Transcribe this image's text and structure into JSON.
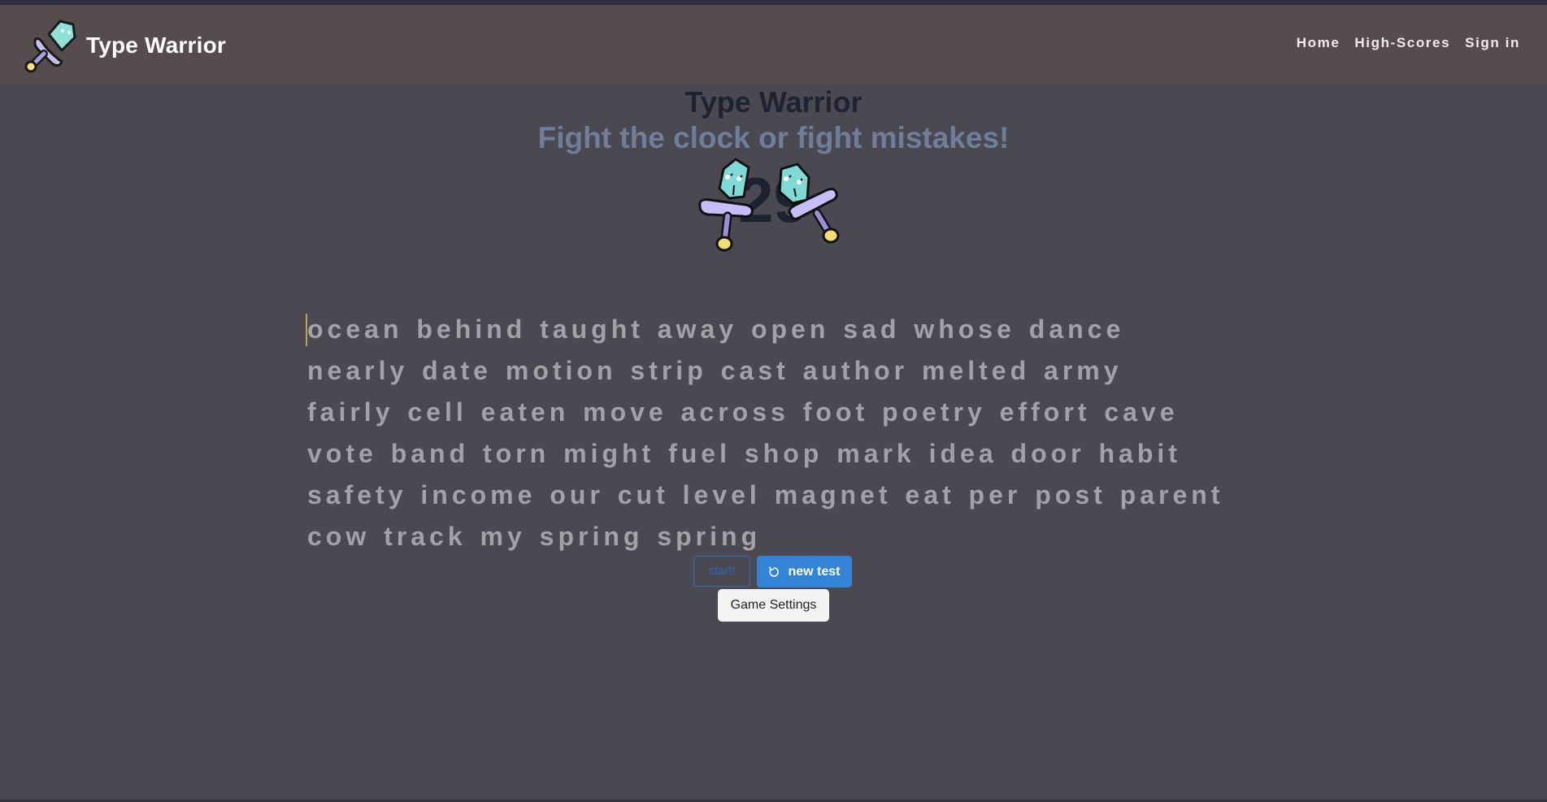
{
  "navbar": {
    "brand_name": "Type Warrior",
    "logo_icon": "crossed-sword-icon",
    "links": [
      "Home",
      "High-Scores",
      "Sign in"
    ]
  },
  "main": {
    "title": "Type Warrior",
    "subtitle": "Fight the clock or fight mistakes!",
    "timer": "29",
    "mascot_icon": "two-swords-mascot-icon",
    "words_lines": [
      "ocean behind taught away open sad whose dance",
      "nearly date motion strip cast author melted army",
      "fairly cell eaten move across foot poetry effort cave",
      "vote band torn might fuel shop mark idea door habit",
      "safety income our cut level magnet eat per post parent",
      "cow track my spring spring"
    ]
  },
  "controls": {
    "start_label": "start!",
    "new_test_label": "new test",
    "new_test_icon": "refresh-icon",
    "settings_label": "Game Settings"
  },
  "colors": {
    "background": "#4a4851",
    "navbar": "#564b4d",
    "accent_button": "#3384d5",
    "subtitle": "#6f7e99",
    "words": "#a3a0a8",
    "caret": "#b4a55a"
  }
}
